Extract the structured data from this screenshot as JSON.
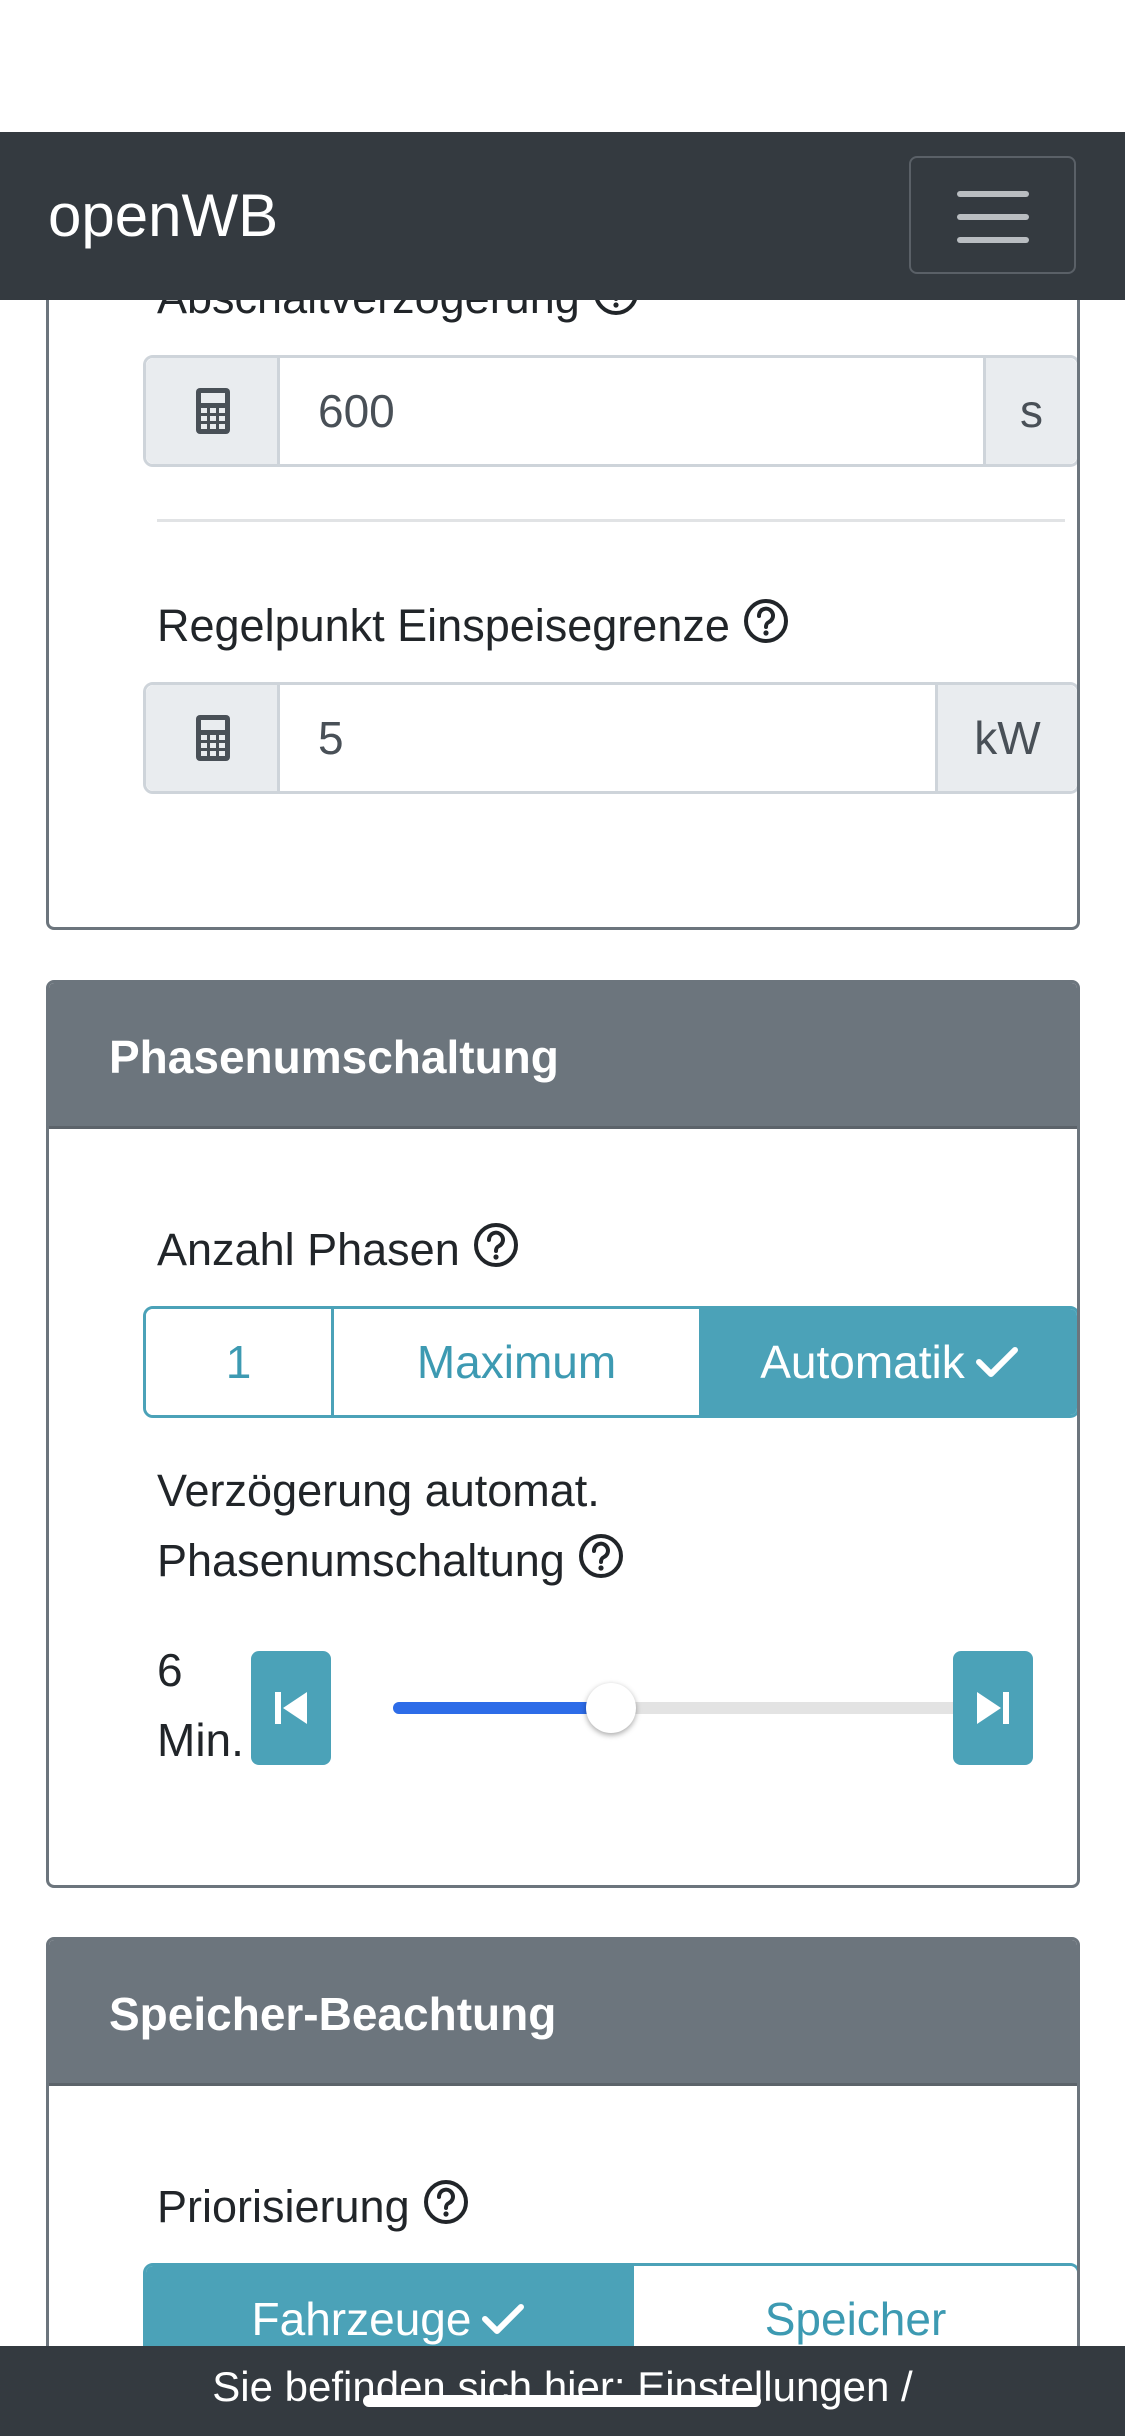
{
  "navbar": {
    "brand": "openWB",
    "menu_icon": "hamburger-menu-icon"
  },
  "cards": {
    "top": {
      "abschalt": {
        "label": "Abschaltverzögerung",
        "value": "600",
        "unit": "s",
        "icon": "calculator-icon"
      },
      "regelpunkt": {
        "label": "Regelpunkt Einspeisegrenze",
        "value": "5",
        "unit": "kW",
        "icon": "calculator-icon"
      }
    },
    "phasen": {
      "title": "Phasenumschaltung",
      "anzahl_label": "Anzahl Phasen",
      "options": [
        "1",
        "Maximum",
        "Automatik"
      ],
      "selected": "Automatik",
      "delay_label_line1": "Verzögerung automat.",
      "delay_label_line2": "Phasenumschaltung",
      "delay_value_number": "6",
      "delay_value_unit": "Min.",
      "delay_value": 6,
      "slider_fraction": 0.37
    },
    "speicher": {
      "title": "Speicher-Beachtung",
      "prio_label": "Priorisierung",
      "options": [
        "Fahrzeuge",
        "Speicher"
      ],
      "selected": "Fahrzeuge"
    }
  },
  "footer": {
    "breadcrumb": "Sie befinden sich hier: Einstellungen /"
  },
  "colors": {
    "navbar": "#343a40",
    "card_header": "#6c757d",
    "accent": "#4ba2b8",
    "slider_fill": "#2d6ce8"
  }
}
